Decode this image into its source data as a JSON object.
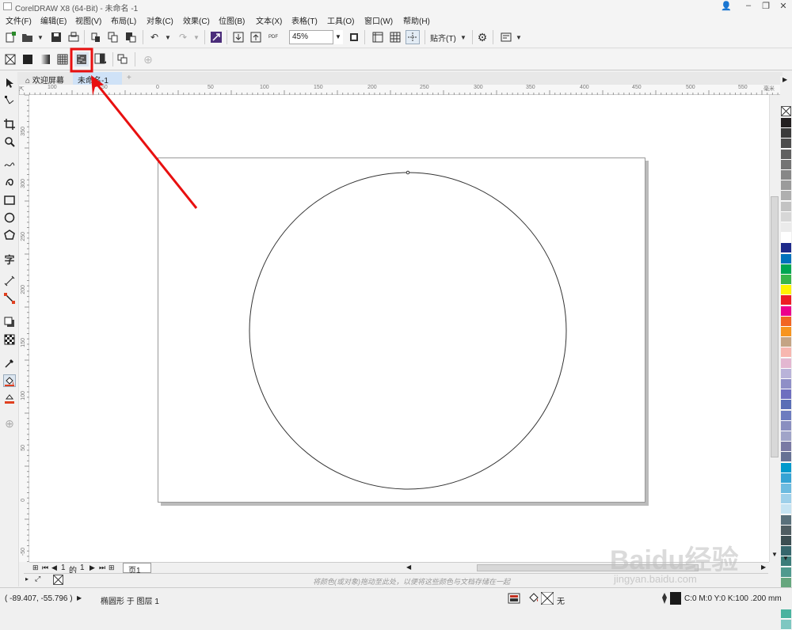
{
  "window": {
    "title": "CorelDRAW X8 (64-Bit) - 未命名 -1",
    "buttons": [
      "👤",
      "–",
      "❐",
      "✕"
    ]
  },
  "menu": [
    "文件(F)",
    "编辑(E)",
    "视图(V)",
    "布局(L)",
    "对象(C)",
    "效果(C)",
    "位图(B)",
    "文本(X)",
    "表格(T)",
    "工具(O)",
    "窗口(W)",
    "帮助(H)"
  ],
  "toolbar": {
    "zoom_value": "45%",
    "snap_label": "贴齐(T)",
    "pdf_label": "PDF"
  },
  "tabs": {
    "welcome": "欢迎屏幕",
    "document": "未命名-1",
    "add": "+"
  },
  "ruler": {
    "h_labels": [
      "100",
      "50",
      "0",
      "50",
      "100",
      "150",
      "200",
      "250",
      "300",
      "350",
      "400",
      "450",
      "500",
      "550"
    ],
    "h_unit": "毫米",
    "v_labels": [
      "350",
      "300",
      "250",
      "200",
      "150",
      "100",
      "50",
      "0",
      "-50"
    ]
  },
  "page_nav": {
    "current": "1",
    "of_label": "的",
    "total": "1",
    "page_tab": "页1"
  },
  "docker_hint": "将颜色(或对象)拖动至此处，以便将这些颜色与文档存储在一起",
  "status": {
    "coords": "( -89.407, -55.796 )",
    "object_info": "椭圆形 于 图层 1",
    "fill_none": "无",
    "outline_info": "C:0 M:0 Y:0 K:100 .200 mm"
  },
  "watermark": {
    "brand": "Baidu经验",
    "url": "jingyan.baidu.com"
  },
  "palette_colors": [
    "#231f20",
    "#3a3a3a",
    "#4d4d4d",
    "#606060",
    "#737373",
    "#878787",
    "#9b9b9b",
    "#afafaf",
    "#c3c3c3",
    "#d7d7d7",
    "#ebebeb",
    "#ffffff",
    "#1e2a8a",
    "#0072bc",
    "#00a651",
    "#39b54a",
    "#fff200",
    "#ed1c24",
    "#ec008c",
    "#f26522",
    "#f7941d",
    "#c4a484",
    "#f7b7b0",
    "#e3b7d1",
    "#b9b3d9",
    "#8f8fc7",
    "#6e6ebf",
    "#5a6eb6",
    "#6d7cbf",
    "#8a8fc0",
    "#a0a4c8",
    "#7a7aa4",
    "#667295",
    "#0099cc",
    "#34a3d4",
    "#6cbbe0",
    "#9ed0ea",
    "#c5e3f2",
    "#59707b",
    "#4f5d62",
    "#3c4e52",
    "#36666c",
    "#3c7d7a",
    "#4f9a8e",
    "#66a67e",
    "#86bba0",
    "#2f9a6b",
    "#49b39f",
    "#7ec7c1"
  ],
  "colors": {
    "annotation_red": "#e81010",
    "page_shadow": "#bbbbbb"
  }
}
